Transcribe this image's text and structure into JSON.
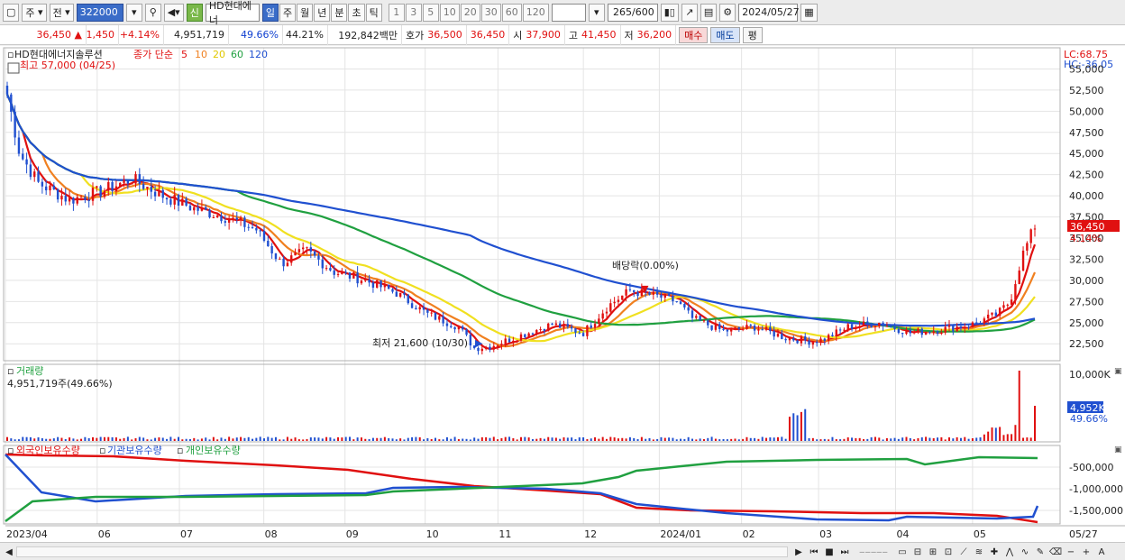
{
  "toolbar": {
    "period_type": "주",
    "prev_label": "전",
    "code": "322000",
    "stock_badge": "신",
    "stock_name": "HD현대에너",
    "periods": [
      "일",
      "주",
      "월",
      "년",
      "분",
      "초",
      "틱"
    ],
    "active_period": "일",
    "intervals": [
      "1",
      "3",
      "5",
      "10",
      "20",
      "30",
      "60",
      "120"
    ],
    "count": "265",
    "count_total": "/600",
    "date": "2024/05/27"
  },
  "quote": {
    "price": "36,450",
    "change_arrow": "▲",
    "change": "1,450",
    "change_pct": "+4.14%",
    "volume": "4,951,719",
    "volume_pct": "49.66%",
    "rate": "44.21%",
    "amount": "192,842백만",
    "bid_label": "호가",
    "bid": "36,500",
    "ask": "36,450",
    "open_label": "시",
    "open": "37,900",
    "high_label": "고",
    "high": "41,450",
    "low_label": "저",
    "low": "36,200",
    "buy_label": "매수",
    "sell_label": "매도",
    "flat_label": "평"
  },
  "price_panel": {
    "title": "HD현대에너지솔루션",
    "ma_label": "종가 단순",
    "ma_periods": [
      "5",
      "10",
      "20",
      "60",
      "120"
    ],
    "ma_colors": [
      "#e01010",
      "#f08020",
      "#f0e020",
      "#20a040",
      "#2050d0"
    ],
    "high_note": "최고 57,000 (04/25)",
    "low_note": "최저 21,600 (10/30)",
    "dividend_note": "배당락(0.00%)",
    "lc": "LC:68.75",
    "hc": "HC:-36.05",
    "y_ticks": [
      "55,000",
      "52,500",
      "50,000",
      "47,500",
      "45,000",
      "42,500",
      "40,000",
      "37,500",
      "35,000",
      "32,500",
      "30,000",
      "27,500",
      "25,000",
      "22,500"
    ],
    "current_price": "36,450",
    "current_pct": "4.14%"
  },
  "volume_panel": {
    "title": "거래량",
    "value_note": "4,951,719주(49.66%)",
    "y_tick": "10,000K",
    "current": "4,952K",
    "current_pct": "49.66%"
  },
  "holding_panel": {
    "series": [
      "외국인보유수량",
      "기관보유수량",
      "개인보유수량"
    ],
    "series_colors": [
      "#e01010",
      "#2050d0",
      "#20a040"
    ],
    "y_ticks": [
      "-500,000",
      "-1,000,000",
      "-1,500,000"
    ]
  },
  "x_axis": [
    "2023/04",
    "06",
    "07",
    "08",
    "09",
    "10",
    "11",
    "12",
    "2024/01",
    "02",
    "03",
    "04",
    "05",
    "05/27"
  ]
}
